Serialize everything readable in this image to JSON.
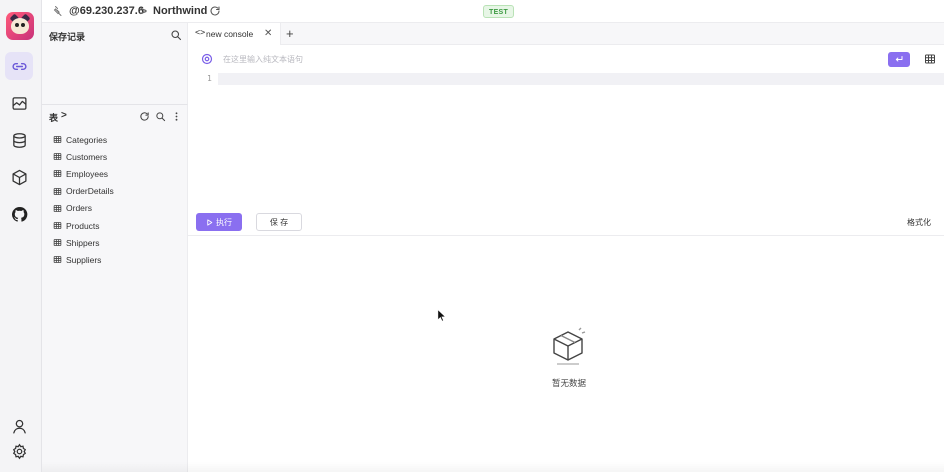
{
  "connection": {
    "host": "@69.230.237.6",
    "separator": ">",
    "database": "Northwind",
    "env_badge": "TEST"
  },
  "saved_panel": {
    "title": "保存记录"
  },
  "tables_panel": {
    "title": "表",
    "chevron": ">",
    "tables": [
      "Categories",
      "Customers",
      "Employees",
      "OrderDetails",
      "Orders",
      "Products",
      "Shippers",
      "Suppliers"
    ]
  },
  "tabs": [
    {
      "icon": "<>",
      "label": "new console",
      "close": "✕"
    }
  ],
  "tab_add": "+",
  "prompt": {
    "placeholder": "在这里输入纯文本语句"
  },
  "editor": {
    "line_numbers": [
      "1"
    ]
  },
  "actions": {
    "run_label": "执行",
    "save_label": "保 存",
    "format_label": "格式化"
  },
  "result": {
    "empty_text": "暂无数据"
  },
  "colors": {
    "accent": "#8a6ff0",
    "badge_green": "#3c9a42",
    "rail_bg": "#f4f4f6"
  },
  "icons": {
    "rail": [
      "connections-icon",
      "dashboard-icon",
      "database-icon",
      "cube-icon",
      "github-icon",
      "user-icon",
      "settings-icon"
    ]
  }
}
